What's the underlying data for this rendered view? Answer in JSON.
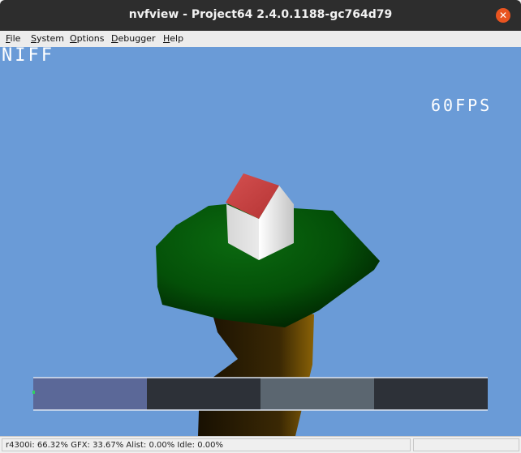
{
  "window": {
    "title": "nvfview - Project64 2.4.0.1188-gc764d79"
  },
  "menu": {
    "items": [
      {
        "u": "F",
        "rest": "ile"
      },
      {
        "u": "S",
        "rest": "ystem"
      },
      {
        "u": "O",
        "rest": "ptions"
      },
      {
        "u": "D",
        "rest": "ebugger"
      },
      {
        "u": "H",
        "rest": "elp"
      }
    ]
  },
  "hud": {
    "title": "NIFF",
    "fps": "60FPS"
  },
  "debug_bar": {
    "segments": [
      {
        "name": "r4300i",
        "color": "#5b6898"
      },
      {
        "name": "GFX",
        "color": "#2d3138"
      },
      {
        "name": "Alist",
        "color": "#5b6670"
      },
      {
        "name": "Idle",
        "color": "#2d3138"
      }
    ]
  },
  "status": {
    "text": "r4300i: 66.32%   GFX: 33.67%   Alist: 0.00%   Idle: 0.00%"
  },
  "colors": {
    "sky": "#6a9bd7",
    "titlebar": "#2d2d2d",
    "close": "#e95420"
  }
}
